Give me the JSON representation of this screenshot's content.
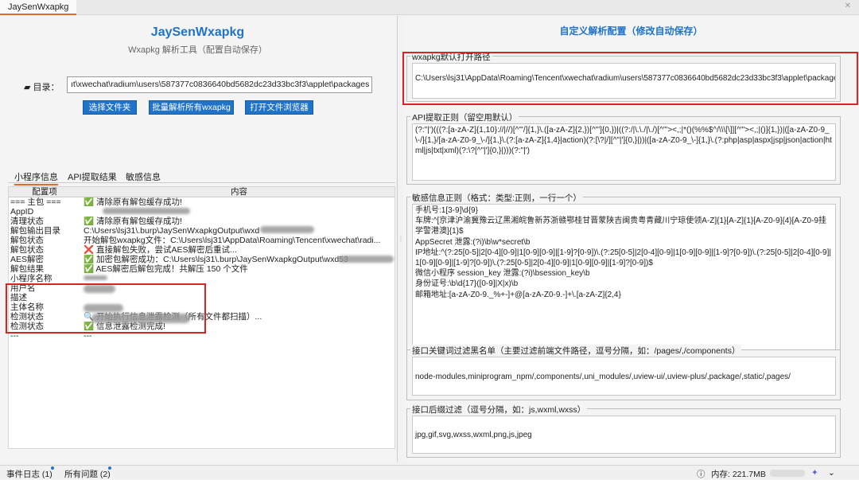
{
  "window": {
    "tab_title": "JaySenWxapkg"
  },
  "left": {
    "title": "JaySenWxapkg",
    "subtitle": "Wxapkg 解析工具（配置自动保存）",
    "dir_label": "目录：",
    "dir_value": "ıt\\xwechat\\radium\\users\\587377c0836640bd5682dc23d33bc3f3\\applet\\packages",
    "buttons": [
      "选择文件夹",
      "批量解析所有wxapkg",
      "打开文件浏览器"
    ],
    "tabs": [
      "小程序信息",
      "API提取结果",
      "敏感信息"
    ],
    "table": {
      "headers": [
        "配置项",
        "内容"
      ],
      "rows": [
        [
          "=== 主包 ===",
          "✅ 清除原有解包缓存成功!"
        ],
        [
          "AppID",
          ""
        ],
        [
          "清理状态",
          "✅ 清除原有解包缓存成功!"
        ],
        [
          "解包输出目录",
          "C:\\Users\\lsj31\\.burp\\JaySenWxapkgOutput\\wxd"
        ],
        [
          "解包状态",
          "开始解包wxapkg文件：C:\\Users\\lsj31\\AppData\\Roaming\\Tencent\\xwechat\\radi..."
        ],
        [
          "解包状态",
          "❌ 直接解包失败，尝试AES解密后重试..."
        ],
        [
          "AES解密",
          "✅ 加密包解密成功：C:\\Users\\lsj31\\.burp\\JaySenWxapkgOutput\\wxd53"
        ],
        [
          "解包结果",
          "✅ AES解密后解包完成！共解压 150 个文件"
        ],
        [
          "小程序名称",
          ""
        ],
        [
          "用户名",
          ""
        ],
        [
          "描述",
          ""
        ],
        [
          "主体名称",
          ""
        ],
        [
          "检测状态",
          "🔍 开始执行信息泄露检测（所有文件都扫描）..."
        ],
        [
          "检测状态",
          "✅ 信息泄露检测完成!"
        ],
        [
          "---",
          "---"
        ]
      ]
    }
  },
  "right": {
    "title": "自定义解析配置（修改自动保存）",
    "groups": [
      {
        "label": "wxapkg默认打开路径",
        "value": "C:\\Users\\lsj31\\AppData\\Roaming\\Tencent\\xwechat\\radium\\users\\587377c0836640bd5682dc23d33bc3f3\\applet\\packages"
      },
      {
        "label": "API提取正则（留空用默认）",
        "value": "(?:\"|')(((?:[a-zA-Z]{1,10}://|//)[^\"'/]{1,}\\.([a-zA-Z]{2,})[^\"']{0,})|((?:/|\\.\\./|\\./)[^\"'><,;|*()(%%$^/\\\\\\[\\]][^\"'><,;|()]{1,})|([a-zA-Z0-9_\\-/]{1,}/[a-zA-Z0-9_\\-/]{1,}\\.(?:[a-zA-Z]{1,4}|action)(?:[\\?|/][^\"|']{0,}|))|([a-zA-Z0-9_\\-]{1,}\\.(?:php|asp|aspx|jsp|json|action|html|js|txt|xml)(?:\\?[^\"|']{0,}|)))(?:\"|')"
      },
      {
        "label": "敏感信息正则（格式：类型:正则，一行一个）",
        "lines": [
          "手机号:1[3-9]\\d{9}",
          "车牌:^[京津沪渝冀豫云辽黑湘皖鲁新苏浙赣鄂桂甘晋蒙陕吉闽贵粤青藏川宁琼使领A-Z]{1}[A-Z]{1}[A-Z0-9]{4}[A-Z0-9挂学警港澳]{1}$",
          "AppSecret 泄露:(?i)\\b\\w*secret\\b",
          "IP地址:^(?:25[0-5]|2[0-4][0-9]|1[0-9][0-9]|[1-9]?[0-9])\\.(?:25[0-5]|2[0-4][0-9]|1[0-9][0-9]|[1-9]?[0-9])\\.(?:25[0-5]|2[0-4][0-9]|1[0-9][0-9]|[1-9]?[0-9])\\.(?:25[0-5]|2[0-4][0-9]|1[0-9][0-9]|[1-9]?[0-9])$",
          "微信小程序 session_key 泄露:(?i)\\bsession_key\\b",
          "身份证号:\\b\\d{17}([0-9]|X|x)\\b",
          "邮箱地址:[a-zA-Z0-9._%+-]+@[a-zA-Z0-9.-]+\\.[a-zA-Z]{2,4}"
        ]
      },
      {
        "label": "接口关键词过滤黑名单（主要过滤前端文件路径，逗号分隔，如：/pages/,/components）",
        "value": "node-modules,miniprogram_npm/,components/,uni_modules/,uview-ui/,uview-plus/,package/,static/,pages/"
      },
      {
        "label": "接口后缀过滤（逗号分隔，如：js,wxml,wxss）",
        "value": "jpg,gif,svg,wxss,wxml,png,js,jpeg"
      }
    ]
  },
  "statusbar": {
    "event_log": "事件日志 (1)",
    "problems": "所有问题 (2)",
    "memory": "内存: 221.7MB"
  }
}
